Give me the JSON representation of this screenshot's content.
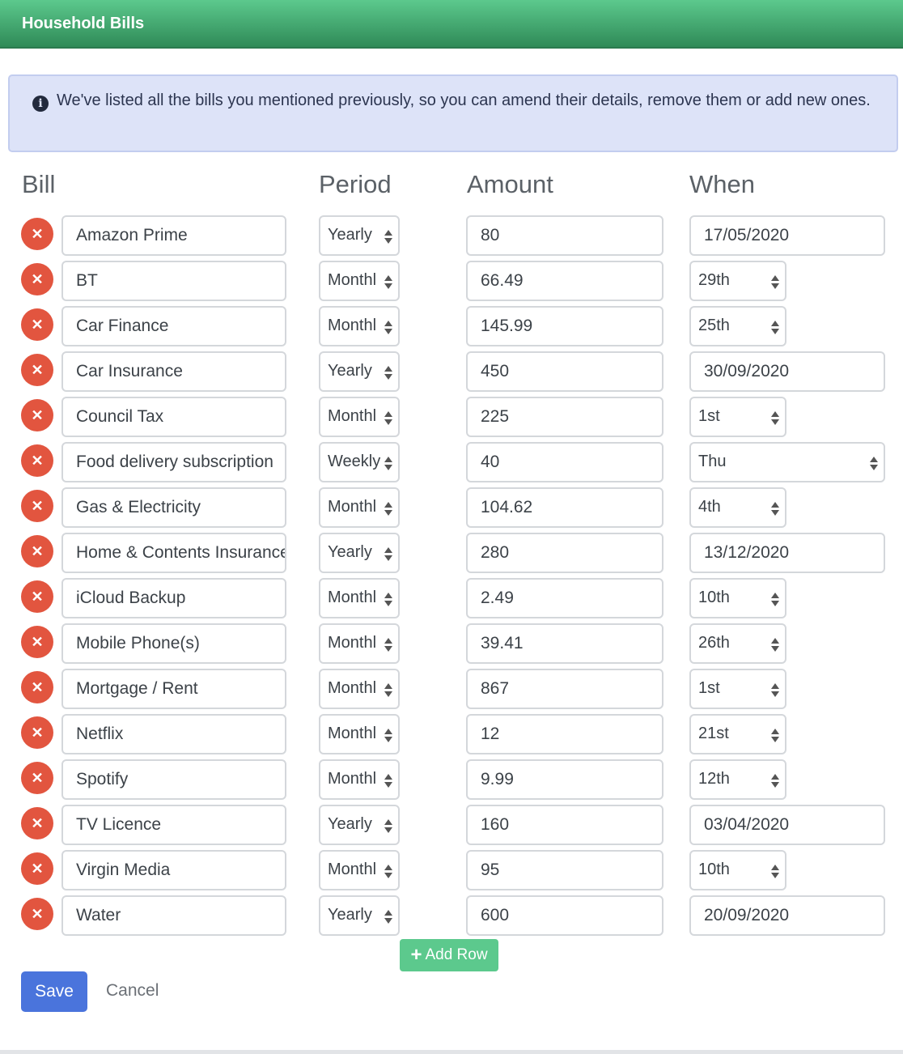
{
  "header": {
    "title": "Household Bills"
  },
  "alert": {
    "icon": "info-circle-icon",
    "text": "We've listed all the bills you mentioned previously, so you can amend their details, remove them or add new ones."
  },
  "columns": {
    "bill": "Bill",
    "period": "Period",
    "amount": "Amount",
    "when": "When"
  },
  "rows": [
    {
      "bill": "Amazon Prime",
      "period": "Yearly",
      "amount": "80",
      "when_type": "date",
      "when": "17/05/2020"
    },
    {
      "bill": "BT",
      "period": "Monthl",
      "amount": "66.49",
      "when_type": "day",
      "when": "29th"
    },
    {
      "bill": "Car Finance",
      "period": "Monthl",
      "amount": "145.99",
      "when_type": "day",
      "when": "25th"
    },
    {
      "bill": "Car Insurance",
      "period": "Yearly",
      "amount": "450",
      "when_type": "date",
      "when": "30/09/2020"
    },
    {
      "bill": "Council Tax",
      "period": "Monthl",
      "amount": "225",
      "when_type": "day",
      "when": "1st"
    },
    {
      "bill": "Food delivery subscription",
      "period": "Weekly",
      "amount": "40",
      "when_type": "weekday",
      "when": "Thu"
    },
    {
      "bill": "Gas & Electricity",
      "period": "Monthl",
      "amount": "104.62",
      "when_type": "day",
      "when": "4th"
    },
    {
      "bill": "Home & Contents Insurance",
      "period": "Yearly",
      "amount": "280",
      "when_type": "date",
      "when": "13/12/2020"
    },
    {
      "bill": "iCloud Backup",
      "period": "Monthl",
      "amount": "2.49",
      "when_type": "day",
      "when": "10th"
    },
    {
      "bill": "Mobile Phone(s)",
      "period": "Monthl",
      "amount": "39.41",
      "when_type": "day",
      "when": "26th"
    },
    {
      "bill": "Mortgage / Rent",
      "period": "Monthl",
      "amount": "867",
      "when_type": "day",
      "when": "1st"
    },
    {
      "bill": "Netflix",
      "period": "Monthl",
      "amount": "12",
      "when_type": "day",
      "when": "21st"
    },
    {
      "bill": "Spotify",
      "period": "Monthl",
      "amount": "9.99",
      "when_type": "day",
      "when": "12th"
    },
    {
      "bill": "TV Licence",
      "period": "Yearly",
      "amount": "160",
      "when_type": "date",
      "when": "03/04/2020"
    },
    {
      "bill": "Virgin Media",
      "period": "Monthl",
      "amount": "95",
      "when_type": "day",
      "when": "10th"
    },
    {
      "bill": "Water",
      "period": "Yearly",
      "amount": "600",
      "when_type": "date",
      "when": "20/09/2020"
    }
  ],
  "buttons": {
    "add_row": "Add Row",
    "save": "Save",
    "cancel": "Cancel"
  },
  "colors": {
    "header": "#3da06a",
    "remove": "#e2553f",
    "save": "#4a74dc",
    "add_row": "#5cc98d",
    "alert_bg": "#dde3f8"
  }
}
